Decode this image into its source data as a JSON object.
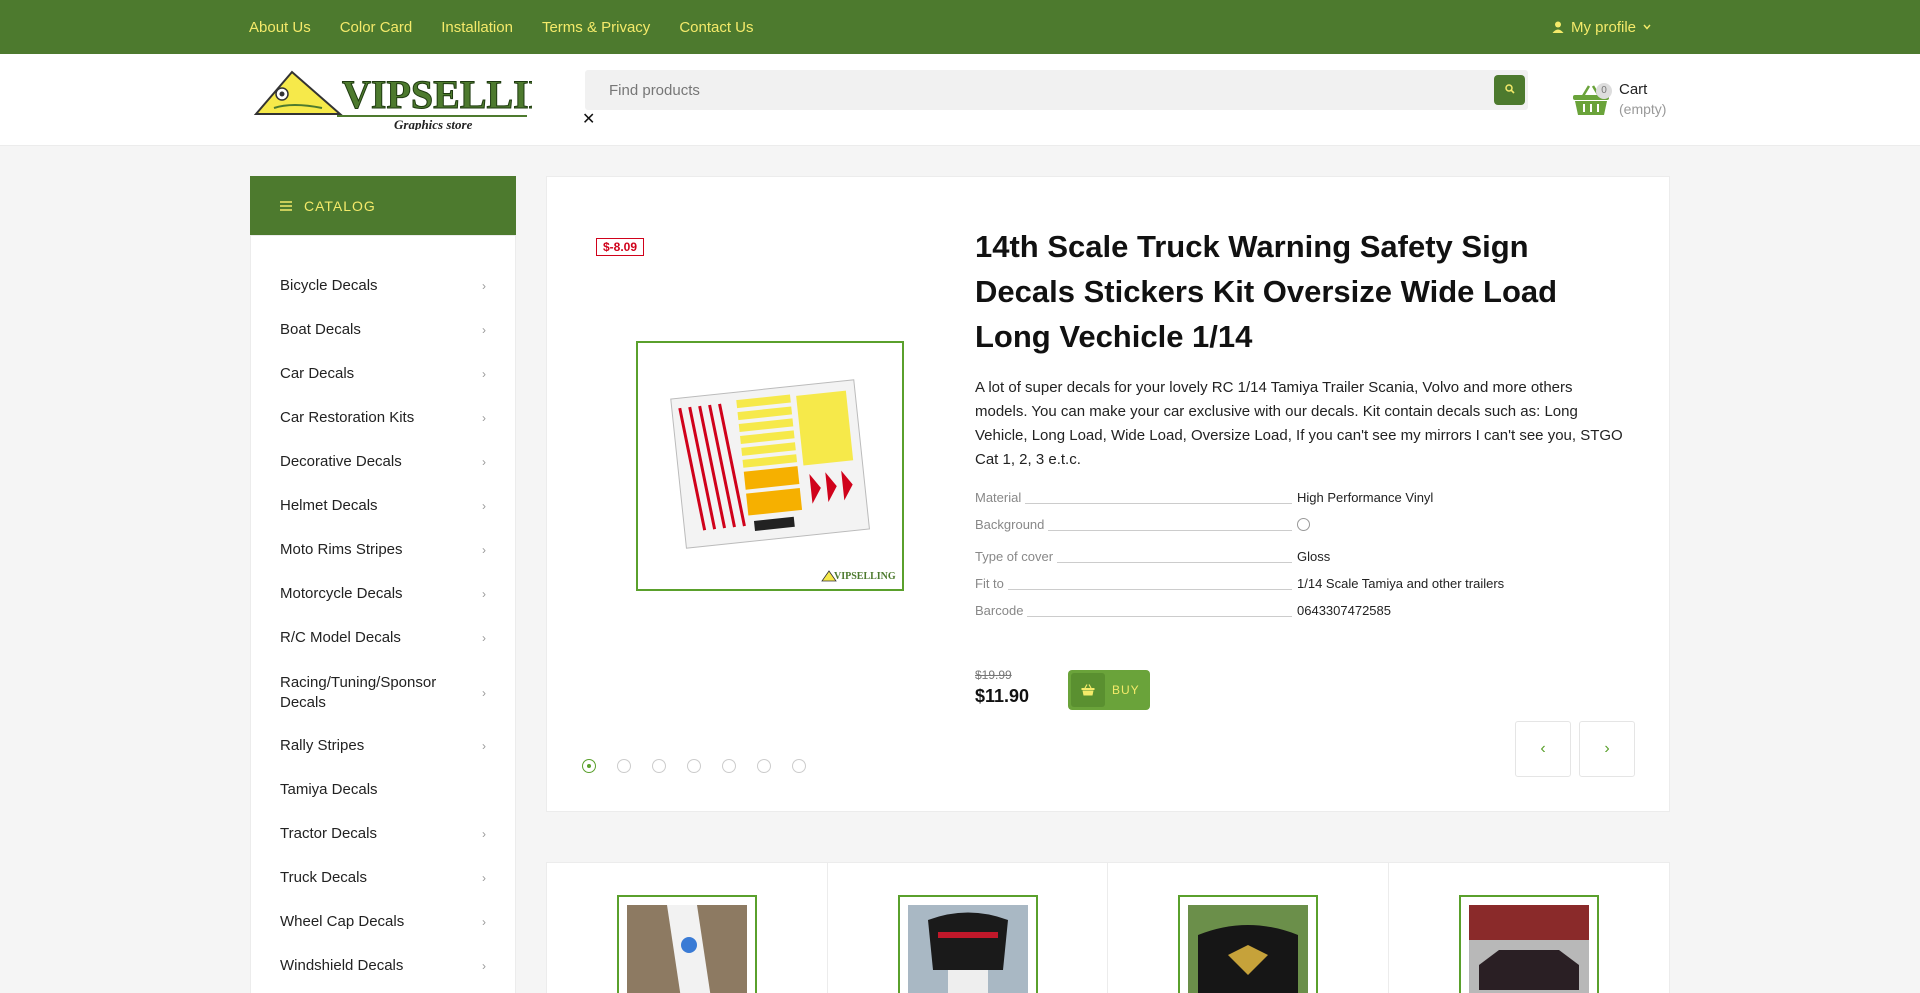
{
  "topnav": {
    "links": [
      "About Us",
      "Color Card",
      "Installation",
      "Terms & Privacy",
      "Contact Us"
    ],
    "profile": "My profile"
  },
  "header": {
    "logo_text": "VIPSELLING",
    "logo_subtext": "Graphics store",
    "search_placeholder": "Find products",
    "clear_symbol": "✕",
    "cart_count": "0",
    "cart_label": "Cart",
    "cart_status": "(empty)"
  },
  "sidebar": {
    "title": "CATALOG",
    "items": [
      {
        "label": "Bicycle Decals",
        "chev": "›"
      },
      {
        "label": "Boat Decals",
        "chev": "›"
      },
      {
        "label": "Car Decals",
        "chev": "›"
      },
      {
        "label": "Car Restoration Kits",
        "chev": "›"
      },
      {
        "label": "Decorative Decals",
        "chev": "›"
      },
      {
        "label": "Helmet Decals",
        "chev": "›"
      },
      {
        "label": "Moto Rims Stripes",
        "chev": "›"
      },
      {
        "label": "Motorcycle Decals",
        "chev": "›"
      },
      {
        "label": "R/C Model Decals",
        "chev": "›"
      },
      {
        "label": "Racing/Tuning/Sponsor Decals",
        "chev": "›"
      },
      {
        "label": "Rally Stripes",
        "chev": "›"
      },
      {
        "label": "Tamiya Decals",
        "chev": ""
      },
      {
        "label": "Tractor Decals",
        "chev": "›"
      },
      {
        "label": "Truck Decals",
        "chev": "›"
      },
      {
        "label": "Wheel Cap Decals",
        "chev": "›"
      },
      {
        "label": "Windshield Decals",
        "chev": "›"
      }
    ]
  },
  "product": {
    "discount": "$-8.09",
    "title": "14th Scale Truck Warning Safety Sign Decals Stickers Kit Oversize Wide Load Long Vechicle 1/14",
    "description": "A lot of super decals for your lovely RC 1/14 Tamiya Trailer Scania, Volvo and more others models. You can make your car exclusive with our decals. Kit contain decals such as: Long Vehicle, Long Load, Wide Load, Oversize Load, If you can't see my mirrors I can't see you, STGO Cat 1, 2, 3 e.t.c.",
    "specs": [
      {
        "label": "Material",
        "value": "High Performance Vinyl"
      },
      {
        "label": "Background",
        "value": ""
      },
      {
        "label": "Type of cover",
        "value": "Gloss"
      },
      {
        "label": "Fit to",
        "value": "1/14 Scale Tamiya and other trailers"
      },
      {
        "label": "Barcode",
        "value": "0643307472585"
      }
    ],
    "old_price": "$19.99",
    "price": "$11.90",
    "buy_label": "BUY",
    "image_watermark": "VIPSELLING",
    "gallery_active_index": 0,
    "gallery_count": 7,
    "prev_symbol": "‹",
    "next_symbol": "›"
  },
  "colors": {
    "brand_green": "#4d7a2e",
    "accent_yellow": "#f4ea6a",
    "frame_green": "#5aa02c",
    "discount_red": "#d0021b"
  }
}
